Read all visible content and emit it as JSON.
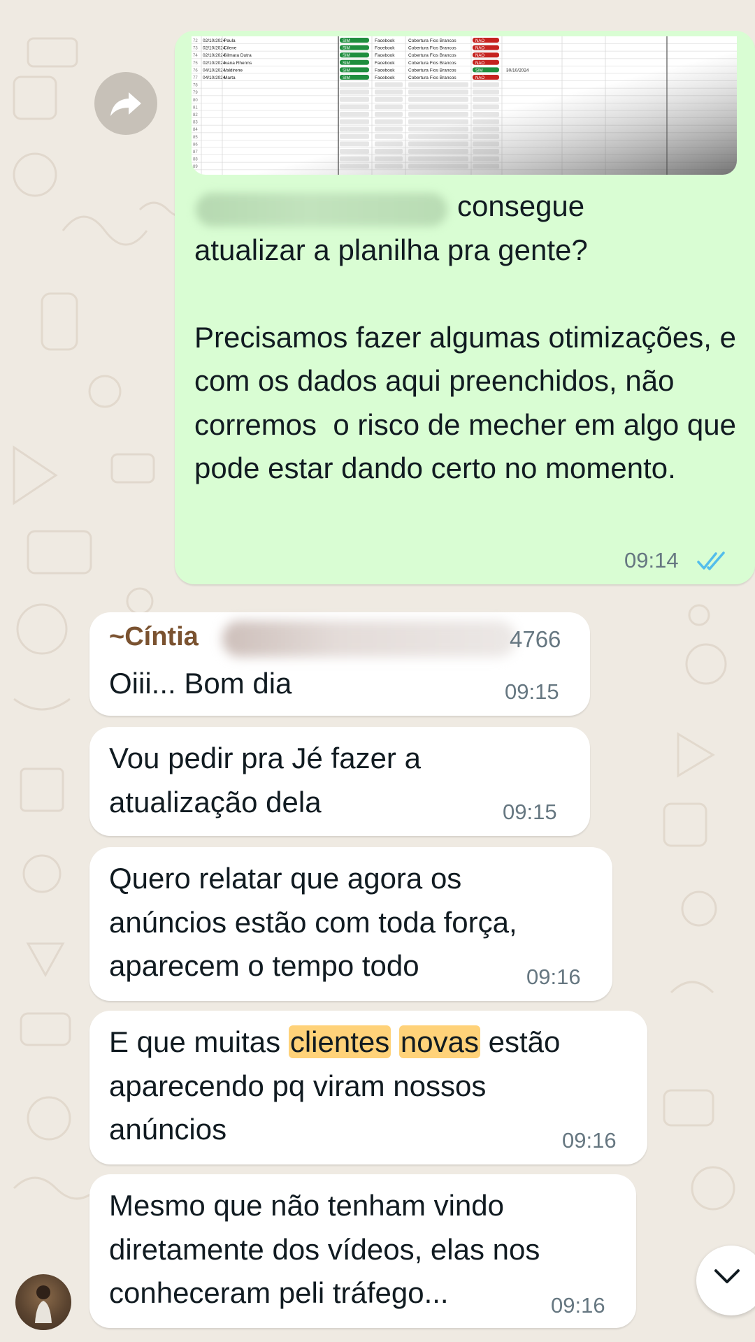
{
  "chat": {
    "outgoing": {
      "text_line1": "consegue",
      "text_rest": "atualizar a planilha pra gente?\n\nPrecisamos fazer algumas otimizações, e com os dados aqui preenchidos, não corremos  o risco de mecher em algo que pode estar dando certo no momento.",
      "time": "09:14",
      "status_icon": "double-check-read-icon"
    },
    "sender": {
      "prefix": "~",
      "name": "Cíntia",
      "phone_suffix": "4766",
      "name_color": "#7a5230"
    },
    "incoming": [
      {
        "text": "Oiii... Bom dia",
        "time": "09:15"
      },
      {
        "text": "Vou pedir pra Jé fazer a\natualização dela",
        "time": "09:15"
      },
      {
        "text": "Quero relatar que agora os\nanúncios estão com toda força,\naparecem o tempo todo",
        "time": "09:16"
      },
      {
        "text_before": "E que muitas ",
        "highlight1": "clientes",
        "highlight2": "novas",
        "text_after": " estão\naparecendo pq viram nossos\nanúncios",
        "time": "09:16"
      },
      {
        "text": "Mesmo que não tenham vindo\ndiretamente dos vídeos, elas nos\nconheceram peli tráfego...",
        "time": "09:16"
      }
    ]
  },
  "spreadsheet": {
    "rows": [
      {
        "num": "72",
        "date": "02/10/2024",
        "name": "Paula",
        "c1": "SIM",
        "c2": "Facebook",
        "c3": "Cobertura Fios Brancos",
        "c4": "NAO",
        "c5": ""
      },
      {
        "num": "73",
        "date": "02/10/2024",
        "name": "Cilene",
        "c1": "SIM",
        "c2": "Facebook",
        "c3": "Cobertura Fios Brancos",
        "c4": "NAO",
        "c5": ""
      },
      {
        "num": "74",
        "date": "02/10/2024",
        "name": "Silmara Dutra",
        "c1": "SIM",
        "c2": "Facebook",
        "c3": "Cobertura Fios Brancos",
        "c4": "NAO",
        "c5": ""
      },
      {
        "num": "75",
        "date": "02/10/2024",
        "name": "Ivana Rhenns",
        "c1": "SIM",
        "c2": "Facebook",
        "c3": "Cobertura Fios Brancos",
        "c4": "NAO",
        "c5": ""
      },
      {
        "num": "76",
        "date": "04/10/2024",
        "name": "Valdirene",
        "c1": "SIM",
        "c2": "Facebook",
        "c3": "Cobertura Fios Brancos",
        "c4": "SIM",
        "c5": "30/10/2024"
      },
      {
        "num": "77",
        "date": "04/10/2024",
        "name": "Marta",
        "c1": "SIM",
        "c2": "Facebook",
        "c3": "Cobertura Fios Brancos",
        "c4": "NAO",
        "c5": ""
      }
    ],
    "empty_rows": [
      "78",
      "79",
      "80",
      "81",
      "82",
      "83",
      "84",
      "85",
      "86",
      "87",
      "88",
      "89"
    ],
    "colors": {
      "sim": "#1e8e3e",
      "nao": "#c5221f"
    }
  },
  "icons": {
    "forward": "forward-arrow-icon",
    "scroll_down": "chevron-down-icon"
  }
}
